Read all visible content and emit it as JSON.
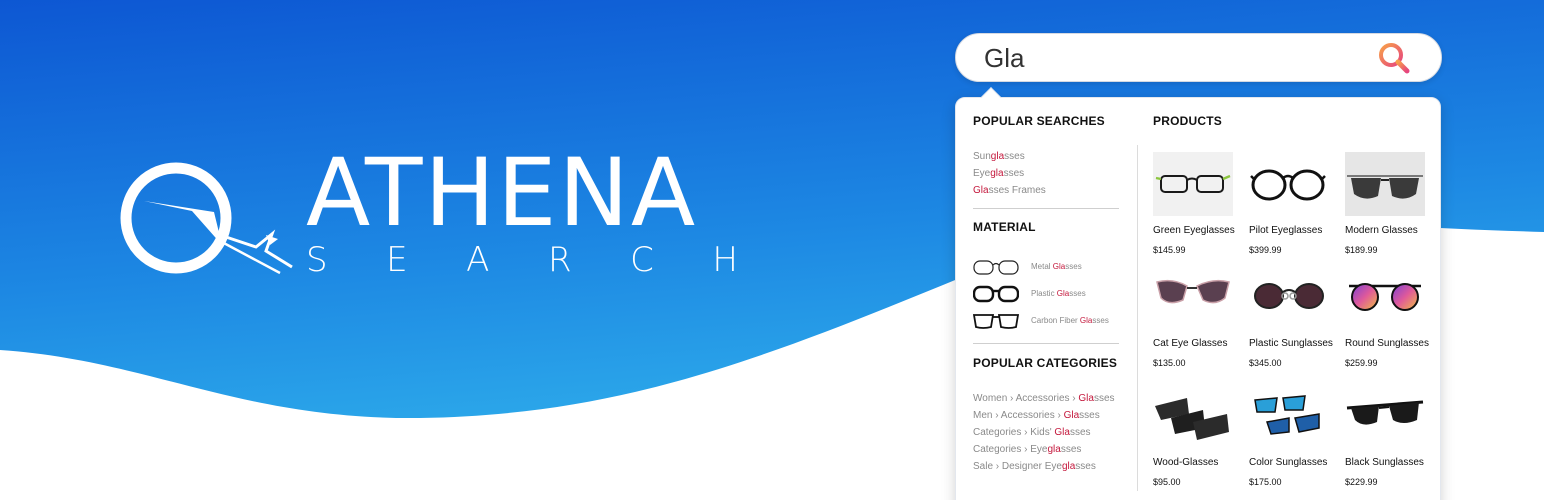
{
  "colors": {
    "gradient_top": "#0d5bd4",
    "gradient_bottom": "#2fb0ea",
    "highlight": "#c4183c",
    "search_icon_start": "#f58a4a",
    "search_icon_end": "#e84e7a"
  },
  "brand": {
    "name": "ATHENA",
    "sub_letters": [
      "S",
      "E",
      "A",
      "R",
      "C",
      "H"
    ]
  },
  "search": {
    "query": "Gla",
    "icon": "search-icon"
  },
  "popular_searches": {
    "title": "POPULAR SEARCHES",
    "items": [
      {
        "pre": "Sun",
        "hl": "gla",
        "post": "sses"
      },
      {
        "pre": "Eye",
        "hl": "gla",
        "post": "sses"
      },
      {
        "pre": "",
        "hl": "Gla",
        "post": "sses Frames"
      }
    ]
  },
  "material": {
    "title": "MATERIAL",
    "items": [
      {
        "icon": "metal-glasses-icon",
        "pre": "Metal ",
        "hl": "Gla",
        "post": "sses"
      },
      {
        "icon": "plastic-glasses-icon",
        "pre": "Plastic ",
        "hl": "Gla",
        "post": "sses"
      },
      {
        "icon": "carbon-fiber-glasses-icon",
        "pre": "Carbon Fiber ",
        "hl": "Gla",
        "post": "sses"
      }
    ]
  },
  "popular_categories": {
    "title": "POPULAR CATEGORIES",
    "items": [
      {
        "pre": "Women › Accessories › ",
        "hl": "Gla",
        "post": "sses"
      },
      {
        "pre": "Men › Accessories › ",
        "hl": "Gla",
        "post": "sses"
      },
      {
        "pre": "Categories › Kids' ",
        "hl": "Gla",
        "post": "sses"
      },
      {
        "pre": "Categories › Eye",
        "hl": "gla",
        "post": "sses"
      },
      {
        "pre": "Sale ›  Designer Eye",
        "hl": "gla",
        "post": "sses"
      }
    ]
  },
  "products": {
    "title": "PRODUCTS",
    "items": [
      {
        "name": "Green Eyeglasses",
        "price": "$145.99",
        "image": "green-eyeglasses-image"
      },
      {
        "name": "Pilot Eyeglasses",
        "price": "$399.99",
        "image": "pilot-eyeglasses-image"
      },
      {
        "name": "Modern Glasses",
        "price": "$189.99",
        "image": "modern-glasses-image"
      },
      {
        "name": "Cat Eye Glasses",
        "price": "$135.00",
        "image": "cat-eye-glasses-image"
      },
      {
        "name": "Plastic Sunglasses",
        "price": "$345.00",
        "image": "plastic-sunglasses-image"
      },
      {
        "name": "Round Sunglasses",
        "price": "$259.99",
        "image": "round-sunglasses-image"
      },
      {
        "name": "Wood-Glasses",
        "price": "$95.00",
        "image": "wood-glasses-image"
      },
      {
        "name": "Color  Sunglasses",
        "price": "$175.00",
        "image": "color-sunglasses-image"
      },
      {
        "name": "Black Sunglasses",
        "price": "$229.99",
        "image": "black-sunglasses-image"
      }
    ]
  }
}
